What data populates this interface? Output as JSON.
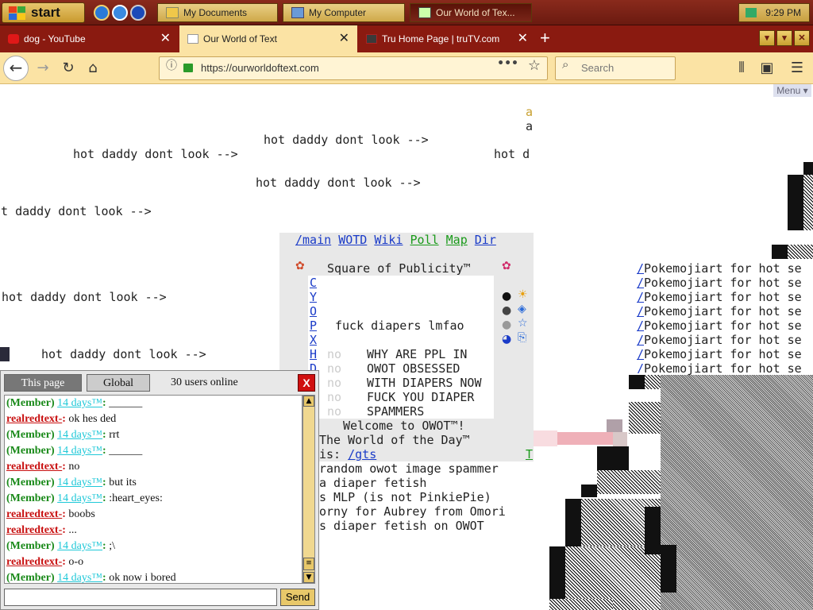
{
  "taskbar": {
    "start_label": "start",
    "tasks": [
      {
        "label": "My Documents"
      },
      {
        "label": "My Computer"
      },
      {
        "label": "Our World of Tex..."
      }
    ],
    "clock": "9:29 PM"
  },
  "browser": {
    "tabs": [
      {
        "label": "dog - YouTube",
        "icon": "youtube-icon"
      },
      {
        "label": "Our World of Text",
        "icon": "owot-icon"
      },
      {
        "label": "Tru Home Page | truTV.com",
        "icon": "trutv-icon"
      }
    ],
    "url": "https://ourworldoftext.com",
    "search_placeholder": "Search",
    "dots": "•••"
  },
  "page": {
    "menu_label": "Menu",
    "hot_text": "hot daddy dont look -->",
    "hot_partial": "hot d",
    "hot_partial_left": "ot daddy dont look -->",
    "letter_a": "a",
    "nav_links": [
      "/main",
      "WOTD",
      "Wiki",
      "Poll",
      "Map",
      "Dir"
    ],
    "square_title": "Square of Publicity™",
    "left_letters": [
      "C",
      "Y",
      "O",
      "P",
      "X",
      "H",
      "D"
    ],
    "square_message": "fuck diapers lmfao",
    "no_label": "no",
    "block_lines": [
      "WHY ARE PPL IN",
      "OWOT OBSESSED",
      "WITH DIAPERS NOW",
      "FUCK YOU DIAPER",
      "SPAMMERS"
    ],
    "welcome": "Welcome to OWOT™!",
    "wotd_line1": "The World of the Day™",
    "wotd_line2": "is: ",
    "wotd_link": "/gts",
    "wotd_t": "T",
    "bottom_lines": [
      "random owot image spammer",
      "a diaper fetish",
      "s MLP (is not PinkiePie)",
      "orny for Aubrey from Omori",
      "s diaper fetish on OWOT"
    ],
    "pokemoji_slash": "/",
    "pokemoji_text": "Pokemojiart for hot se",
    "pokemoji_count": 8
  },
  "chat": {
    "tab_page": "This page",
    "tab_global": "Global",
    "online": "30 users online",
    "close": "X",
    "send": "Send",
    "input_value": "",
    "messages": [
      {
        "kind": "member",
        "name": "(Member)",
        "time": "14 days™",
        "text": " ______"
      },
      {
        "kind": "red",
        "name": "realredtext-",
        "text": " ok hes ded"
      },
      {
        "kind": "member",
        "name": "(Member)",
        "time": "14 days™",
        "text": " rrt"
      },
      {
        "kind": "member",
        "name": "(Member)",
        "time": "14 days™",
        "text": " ______"
      },
      {
        "kind": "red",
        "name": "realredtext-",
        "text": " no"
      },
      {
        "kind": "member",
        "name": "(Member)",
        "time": "14 days™",
        "text": " but its"
      },
      {
        "kind": "member",
        "name": "(Member)",
        "time": "14 days™",
        "text": " :heart_eyes:"
      },
      {
        "kind": "red",
        "name": "realredtext-",
        "text": " boobs"
      },
      {
        "kind": "red",
        "name": "realredtext-",
        "text": " ..."
      },
      {
        "kind": "member",
        "name": "(Member)",
        "time": "14 days™",
        "text": " ;\\"
      },
      {
        "kind": "red",
        "name": "realredtext-",
        "text": " o-o"
      },
      {
        "kind": "member",
        "name": "(Member)",
        "time": "14 days™",
        "text": " ok now i bored"
      }
    ]
  },
  "colors": {
    "taskbar": "#7a1f14",
    "tab_active": "#fbe3a4",
    "link_blue": "#1a3bc8",
    "link_green": "#1a9a1a",
    "chat_member": "#1a8a1a",
    "chat_red": "#c81010",
    "chat_days": "#1fc8d8"
  }
}
